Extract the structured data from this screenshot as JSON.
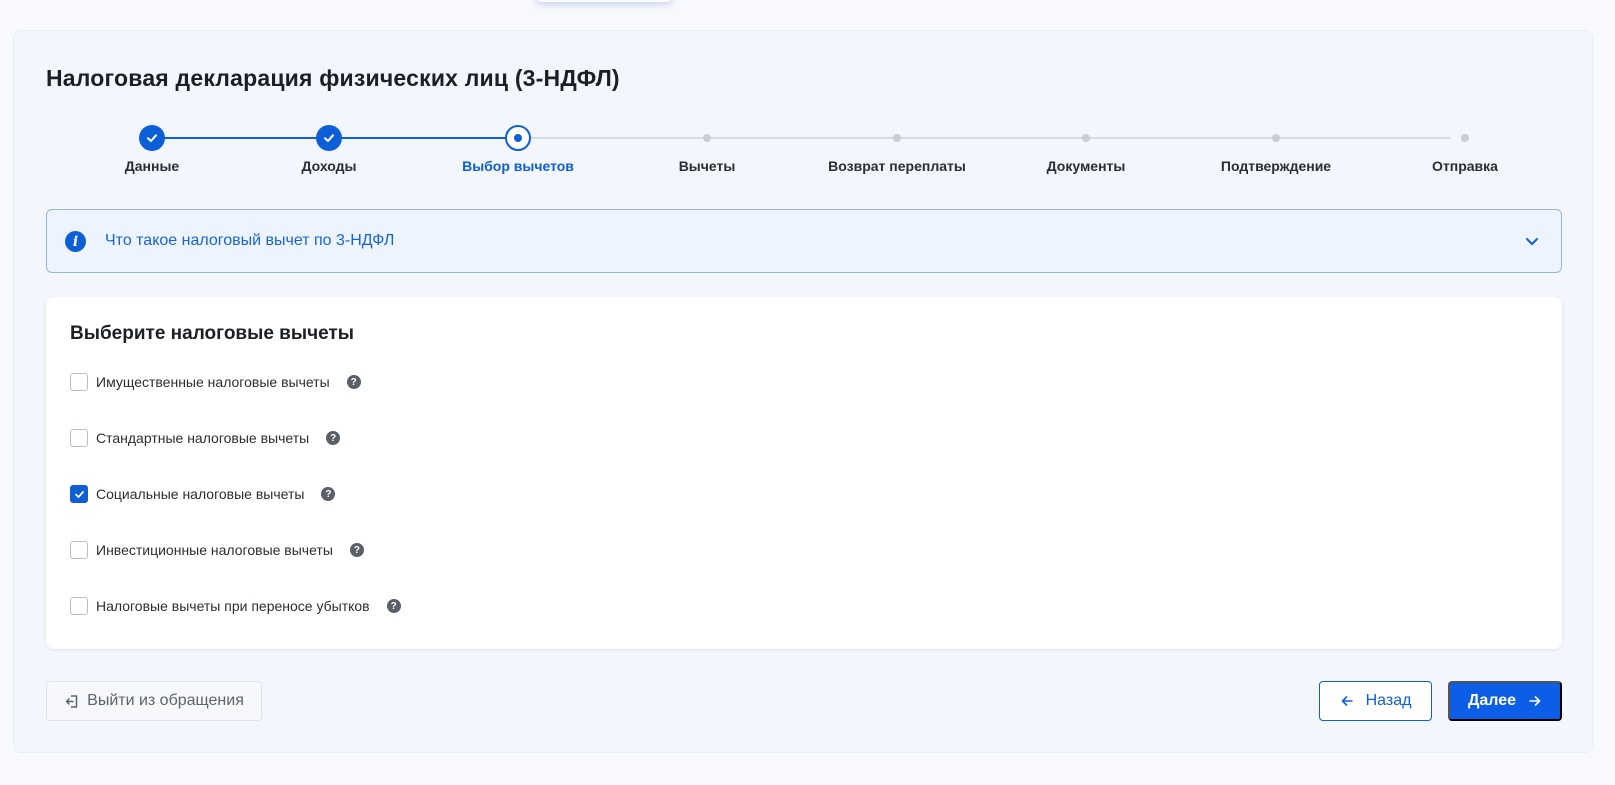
{
  "page": {
    "title": "Налоговая декларация физических лиц (3-НДФЛ)"
  },
  "stepper": {
    "steps": [
      {
        "label": "Данные",
        "state": "done"
      },
      {
        "label": "Доходы",
        "state": "done"
      },
      {
        "label": "Выбор вычетов",
        "state": "current"
      },
      {
        "label": "Вычеты",
        "state": "todo"
      },
      {
        "label": "Возврат переплаты",
        "state": "todo"
      },
      {
        "label": "Документы",
        "state": "todo"
      },
      {
        "label": "Подтверждение",
        "state": "todo"
      },
      {
        "label": "Отправка",
        "state": "todo"
      }
    ]
  },
  "info": {
    "text": "Что такое налоговый вычет по 3-НДФЛ",
    "icon": "info-icon",
    "expand_icon": "chevron-down-icon"
  },
  "deductions": {
    "title": "Выберите налоговые вычеты",
    "options": [
      {
        "label": "Имущественные налоговые вычеты",
        "checked": false
      },
      {
        "label": "Стандартные налоговые вычеты",
        "checked": false
      },
      {
        "label": "Социальные налоговые вычеты",
        "checked": true
      },
      {
        "label": "Инвестиционные налоговые вычеты",
        "checked": false
      },
      {
        "label": "Налоговые вычеты при переносе убытков",
        "checked": false
      }
    ],
    "help_glyph": "?"
  },
  "footer": {
    "exit_label": "Выйти из обращения",
    "back_label": "Назад",
    "next_label": "Далее"
  },
  "colors": {
    "accent": "#0d5fd8",
    "primary_button": "#0b5ee5",
    "inactive": "#c9ced6"
  }
}
